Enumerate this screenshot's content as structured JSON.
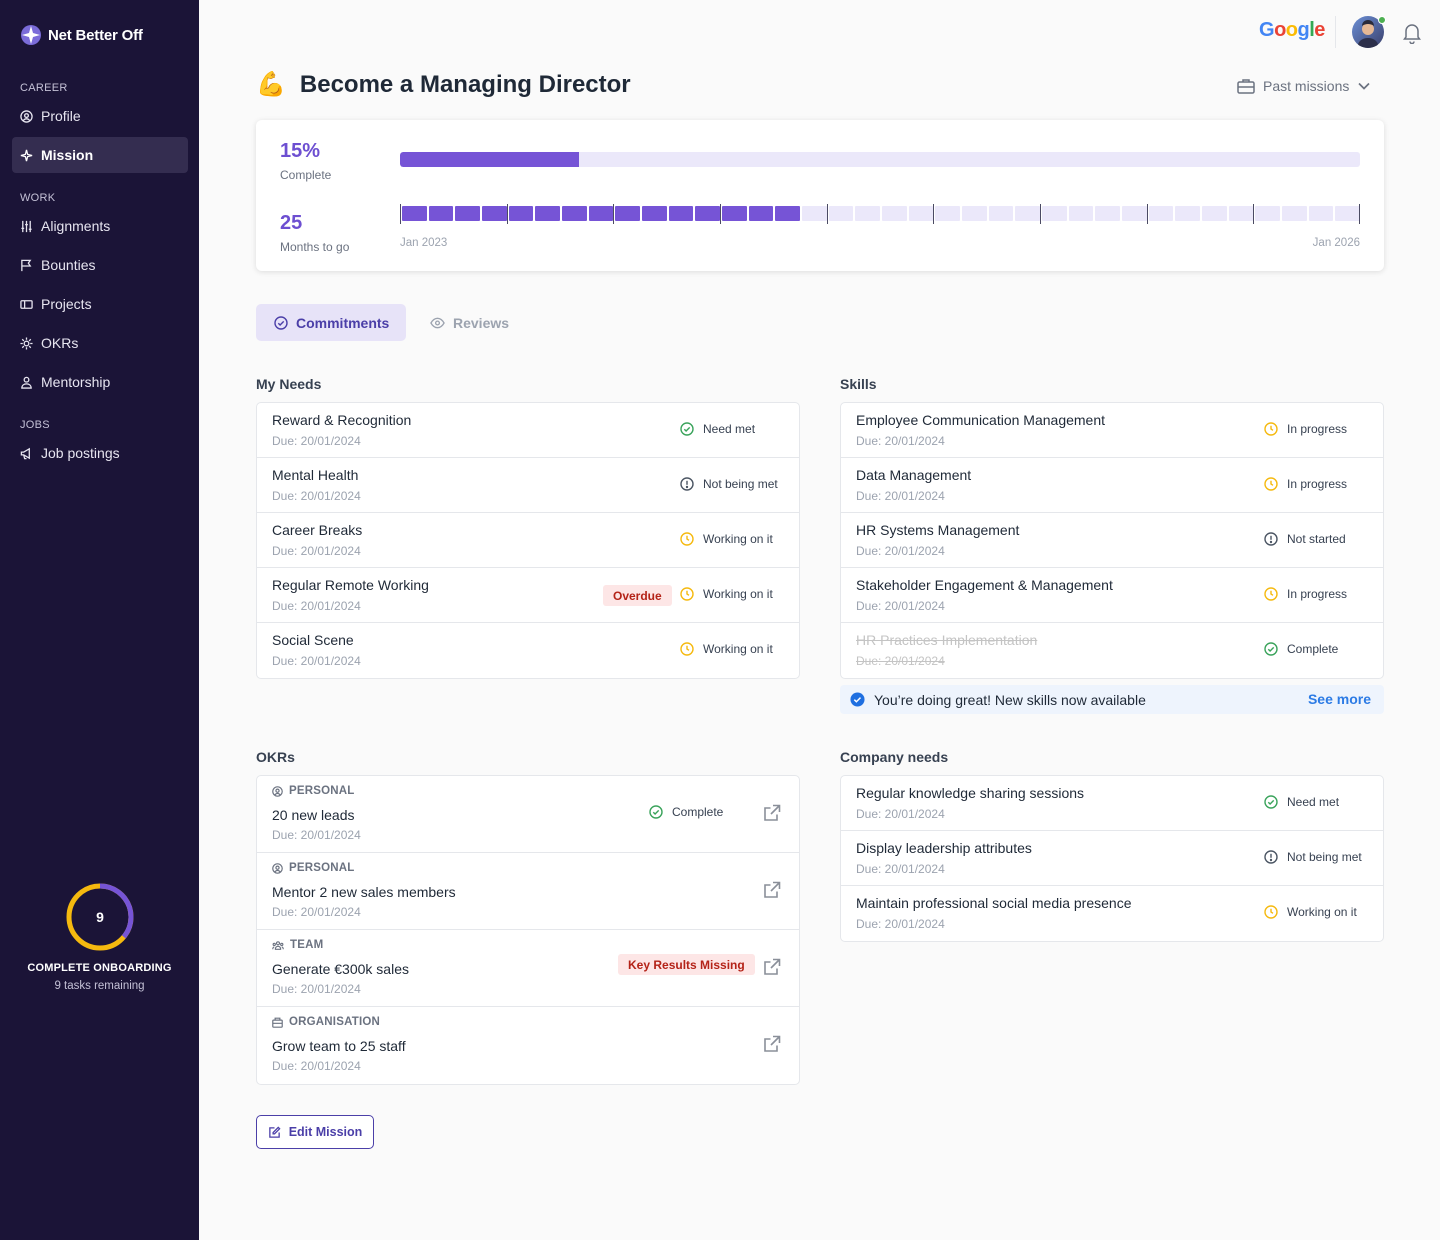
{
  "brand": {
    "name": "Net Better Off"
  },
  "sidebar": {
    "sections": [
      {
        "label": "CAREER",
        "items": [
          {
            "label": "Profile"
          },
          {
            "label": "Mission",
            "active": true
          }
        ]
      },
      {
        "label": "WORK",
        "items": [
          {
            "label": "Alignments"
          },
          {
            "label": "Bounties"
          },
          {
            "label": "Projects"
          },
          {
            "label": "OKRs"
          },
          {
            "label": "Mentorship"
          }
        ]
      },
      {
        "label": "JOBS",
        "items": [
          {
            "label": "Job postings"
          }
        ]
      }
    ],
    "onboarding": {
      "count": "9",
      "title": "COMPLETE ONBOARDING",
      "subtitle": "9 tasks remaining",
      "progress": 0.36
    }
  },
  "topbar": {
    "company": "Google"
  },
  "page": {
    "title": "Become a Managing Director",
    "emoji": "💪",
    "past_missions": "Past missions"
  },
  "progress": {
    "percent": "15%",
    "percent_label": "Complete",
    "percent_value": 0.186,
    "months": "25",
    "months_label": "Months to go",
    "start": "Jan 2023",
    "end": "Jan 2026",
    "months_total": 36,
    "months_elapsed": 15
  },
  "tabs": [
    {
      "label": "Commitments",
      "active": true
    },
    {
      "label": "Reviews"
    }
  ],
  "my_needs": {
    "title": "My Needs",
    "items": [
      {
        "name": "Reward & Recognition",
        "due": "Due: 20/01/2024",
        "status": "Need met",
        "icon": "check"
      },
      {
        "name": "Mental Health",
        "due": "Due: 20/01/2024",
        "status": "Not being met",
        "icon": "alert"
      },
      {
        "name": "Career Breaks",
        "due": "Due: 20/01/2024",
        "status": "Working on it",
        "icon": "clock"
      },
      {
        "name": "Regular Remote Working",
        "due": "Due: 20/01/2024",
        "status": "Working on it",
        "icon": "clock",
        "badge": "Overdue"
      },
      {
        "name": "Social Scene",
        "due": "Due: 20/01/2024",
        "status": "Working on it",
        "icon": "clock"
      }
    ]
  },
  "skills": {
    "title": "Skills",
    "items": [
      {
        "name": "Employee Communication Management",
        "due": "Due: 20/01/2024",
        "status": "In progress",
        "icon": "clock"
      },
      {
        "name": "Data Management",
        "due": "Due: 20/01/2024",
        "status": "In progress",
        "icon": "clock"
      },
      {
        "name": "HR Systems Management",
        "due": "Due: 20/01/2024",
        "status": "Not started",
        "icon": "alert"
      },
      {
        "name": "Stakeholder Engagement & Management",
        "due": "Due: 20/01/2024",
        "status": "In progress",
        "icon": "clock"
      },
      {
        "name": "HR Practices Implementation",
        "due": "Due: 20/01/2024",
        "status": "Complete",
        "icon": "check",
        "done": true
      }
    ],
    "banner": "You’re doing great! New skills now available",
    "see_more": "See more"
  },
  "okrs": {
    "title": "OKRs",
    "items": [
      {
        "type": "PERSONAL",
        "type_icon": "person",
        "name": "20 new leads",
        "due": "Due: 20/01/2024",
        "status": "Complete",
        "icon": "check"
      },
      {
        "type": "PERSONAL",
        "type_icon": "person",
        "name": "Mentor 2 new sales members",
        "due": "Due: 20/01/2024"
      },
      {
        "type": "TEAM",
        "type_icon": "team",
        "name": "Generate €300k sales",
        "due": "Due: 20/01/2024",
        "badge": "Key Results Missing"
      },
      {
        "type": "ORGANISATION",
        "type_icon": "org",
        "name": "Grow team to 25 staff",
        "due": "Due: 20/01/2024"
      }
    ]
  },
  "company_needs": {
    "title": "Company needs",
    "items": [
      {
        "name": "Regular knowledge sharing sessions",
        "due": "Due: 20/01/2024",
        "status": "Need met",
        "icon": "check"
      },
      {
        "name": "Display leadership attributes",
        "due": "Due: 20/01/2024",
        "status": "Not being met",
        "icon": "alert"
      },
      {
        "name": "Maintain professional social media presence",
        "due": "Due: 20/01/2024",
        "status": "Working on it",
        "icon": "clock"
      }
    ]
  },
  "edit_button": "Edit Mission",
  "colors": {
    "accent": "#6d4fd1",
    "sidebar": "#1b1437",
    "ok": "#3aa35b",
    "warn": "#f5b90f",
    "danger": "#b42318",
    "muted": "#4b5563"
  }
}
